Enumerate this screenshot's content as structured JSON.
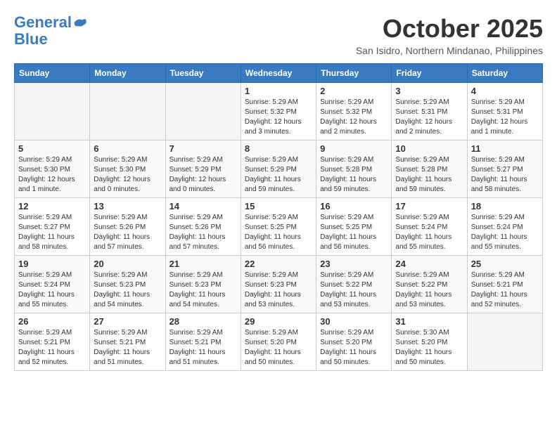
{
  "header": {
    "logo_line1": "General",
    "logo_line2": "Blue",
    "month": "October 2025",
    "location": "San Isidro, Northern Mindanao, Philippines"
  },
  "weekdays": [
    "Sunday",
    "Monday",
    "Tuesday",
    "Wednesday",
    "Thursday",
    "Friday",
    "Saturday"
  ],
  "weeks": [
    [
      {
        "day": "",
        "info": ""
      },
      {
        "day": "",
        "info": ""
      },
      {
        "day": "",
        "info": ""
      },
      {
        "day": "1",
        "info": "Sunrise: 5:29 AM\nSunset: 5:32 PM\nDaylight: 12 hours\nand 3 minutes."
      },
      {
        "day": "2",
        "info": "Sunrise: 5:29 AM\nSunset: 5:32 PM\nDaylight: 12 hours\nand 2 minutes."
      },
      {
        "day": "3",
        "info": "Sunrise: 5:29 AM\nSunset: 5:31 PM\nDaylight: 12 hours\nand 2 minutes."
      },
      {
        "day": "4",
        "info": "Sunrise: 5:29 AM\nSunset: 5:31 PM\nDaylight: 12 hours\nand 1 minute."
      }
    ],
    [
      {
        "day": "5",
        "info": "Sunrise: 5:29 AM\nSunset: 5:30 PM\nDaylight: 12 hours\nand 1 minute."
      },
      {
        "day": "6",
        "info": "Sunrise: 5:29 AM\nSunset: 5:30 PM\nDaylight: 12 hours\nand 0 minutes."
      },
      {
        "day": "7",
        "info": "Sunrise: 5:29 AM\nSunset: 5:29 PM\nDaylight: 12 hours\nand 0 minutes."
      },
      {
        "day": "8",
        "info": "Sunrise: 5:29 AM\nSunset: 5:29 PM\nDaylight: 11 hours\nand 59 minutes."
      },
      {
        "day": "9",
        "info": "Sunrise: 5:29 AM\nSunset: 5:28 PM\nDaylight: 11 hours\nand 59 minutes."
      },
      {
        "day": "10",
        "info": "Sunrise: 5:29 AM\nSunset: 5:28 PM\nDaylight: 11 hours\nand 59 minutes."
      },
      {
        "day": "11",
        "info": "Sunrise: 5:29 AM\nSunset: 5:27 PM\nDaylight: 11 hours\nand 58 minutes."
      }
    ],
    [
      {
        "day": "12",
        "info": "Sunrise: 5:29 AM\nSunset: 5:27 PM\nDaylight: 11 hours\nand 58 minutes."
      },
      {
        "day": "13",
        "info": "Sunrise: 5:29 AM\nSunset: 5:26 PM\nDaylight: 11 hours\nand 57 minutes."
      },
      {
        "day": "14",
        "info": "Sunrise: 5:29 AM\nSunset: 5:26 PM\nDaylight: 11 hours\nand 57 minutes."
      },
      {
        "day": "15",
        "info": "Sunrise: 5:29 AM\nSunset: 5:25 PM\nDaylight: 11 hours\nand 56 minutes."
      },
      {
        "day": "16",
        "info": "Sunrise: 5:29 AM\nSunset: 5:25 PM\nDaylight: 11 hours\nand 56 minutes."
      },
      {
        "day": "17",
        "info": "Sunrise: 5:29 AM\nSunset: 5:24 PM\nDaylight: 11 hours\nand 55 minutes."
      },
      {
        "day": "18",
        "info": "Sunrise: 5:29 AM\nSunset: 5:24 PM\nDaylight: 11 hours\nand 55 minutes."
      }
    ],
    [
      {
        "day": "19",
        "info": "Sunrise: 5:29 AM\nSunset: 5:24 PM\nDaylight: 11 hours\nand 55 minutes."
      },
      {
        "day": "20",
        "info": "Sunrise: 5:29 AM\nSunset: 5:23 PM\nDaylight: 11 hours\nand 54 minutes."
      },
      {
        "day": "21",
        "info": "Sunrise: 5:29 AM\nSunset: 5:23 PM\nDaylight: 11 hours\nand 54 minutes."
      },
      {
        "day": "22",
        "info": "Sunrise: 5:29 AM\nSunset: 5:23 PM\nDaylight: 11 hours\nand 53 minutes."
      },
      {
        "day": "23",
        "info": "Sunrise: 5:29 AM\nSunset: 5:22 PM\nDaylight: 11 hours\nand 53 minutes."
      },
      {
        "day": "24",
        "info": "Sunrise: 5:29 AM\nSunset: 5:22 PM\nDaylight: 11 hours\nand 53 minutes."
      },
      {
        "day": "25",
        "info": "Sunrise: 5:29 AM\nSunset: 5:21 PM\nDaylight: 11 hours\nand 52 minutes."
      }
    ],
    [
      {
        "day": "26",
        "info": "Sunrise: 5:29 AM\nSunset: 5:21 PM\nDaylight: 11 hours\nand 52 minutes."
      },
      {
        "day": "27",
        "info": "Sunrise: 5:29 AM\nSunset: 5:21 PM\nDaylight: 11 hours\nand 51 minutes."
      },
      {
        "day": "28",
        "info": "Sunrise: 5:29 AM\nSunset: 5:21 PM\nDaylight: 11 hours\nand 51 minutes."
      },
      {
        "day": "29",
        "info": "Sunrise: 5:29 AM\nSunset: 5:20 PM\nDaylight: 11 hours\nand 50 minutes."
      },
      {
        "day": "30",
        "info": "Sunrise: 5:29 AM\nSunset: 5:20 PM\nDaylight: 11 hours\nand 50 minutes."
      },
      {
        "day": "31",
        "info": "Sunrise: 5:30 AM\nSunset: 5:20 PM\nDaylight: 11 hours\nand 50 minutes."
      },
      {
        "day": "",
        "info": ""
      }
    ]
  ]
}
